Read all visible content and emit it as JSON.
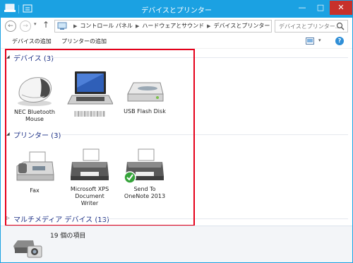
{
  "window": {
    "title": "デバイスとプリンター",
    "minimize_glyph": "—",
    "maximize_glyph": "□",
    "close_glyph": "✕",
    "accent_color": "#1ba1e2",
    "close_color": "#c7312b"
  },
  "nav": {
    "back_glyph": "←",
    "forward_glyph": "→",
    "dropdown_glyph": "▾",
    "up_glyph": "↑"
  },
  "address": {
    "breadcrumb": [
      "コントロール パネル",
      "ハードウェアとサウンド",
      "デバイスとプリンター"
    ],
    "sep": "▶",
    "dropdown_glyph": "▾",
    "refresh_glyph": "↻"
  },
  "search": {
    "placeholder": "デバイスとプリンター..."
  },
  "toolbar": {
    "add_device": "デバイスの追加",
    "add_printer": "プリンターの追加",
    "view_dropdown_glyph": "▾",
    "help_glyph": "?"
  },
  "groups": {
    "devices": {
      "arrow": "◢",
      "title": "デバイス (3)",
      "items": [
        {
          "label": "NEC Bluetooth\nMouse",
          "icon": "mouse-icon"
        },
        {
          "label": "",
          "icon": "laptop-icon",
          "label_obscured": true
        },
        {
          "label": "USB Flash Disk",
          "icon": "usb-drive-icon"
        }
      ]
    },
    "printers": {
      "arrow": "◢",
      "title": "プリンター (3)",
      "items": [
        {
          "label": "Fax",
          "icon": "fax-icon"
        },
        {
          "label": "Microsoft XPS\nDocument\nWriter",
          "icon": "printer-icon"
        },
        {
          "label": "Send To\nOneNote 2013",
          "icon": "printer-default-icon",
          "is_default": true
        }
      ]
    },
    "multimedia": {
      "arrow": "▷",
      "title": "マルチメディア デバイス (13)"
    }
  },
  "details": {
    "item_count": "19 個の項目"
  },
  "annotation": {
    "highlight_color": "#e5001a"
  }
}
